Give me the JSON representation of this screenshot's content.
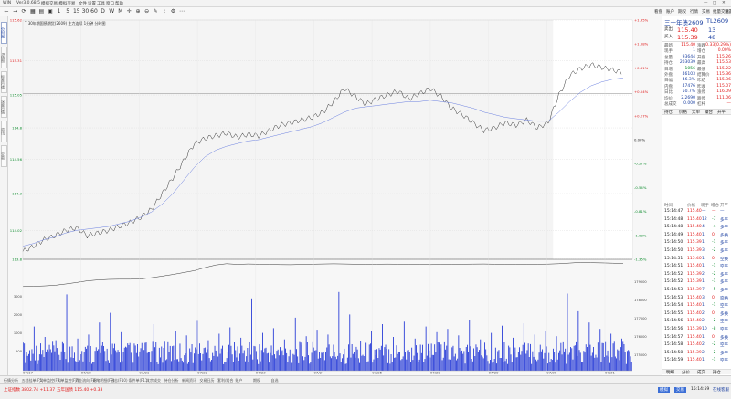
{
  "title_bar": {
    "app": "WIN",
    "version": "Ver3.0.68.5",
    "account": "模拟交易 模拟交易",
    "items": [
      "文件",
      "设置",
      "工具",
      "窗口",
      "帮助"
    ]
  },
  "window_controls": {
    "minimize": "—",
    "maximize": "□",
    "close": "✕"
  },
  "toolbar": {
    "icons": [
      "arrow-left-icon",
      "arrow-right-icon",
      "refresh-icon",
      "grid-icon",
      "doc-icon",
      "monitor-icon",
      "number-1-icon",
      "number-5-icon",
      "number-15-icon",
      "number-30-icon",
      "number-60-icon",
      "day-icon",
      "week-icon",
      "month-icon",
      "cross-icon",
      "zoom-in-icon",
      "zoom-out-icon",
      "draw-icon",
      "indicator-icon",
      "settings-icon",
      "more-icon"
    ],
    "glyphs": [
      "←",
      "→",
      "⟳",
      "▦",
      "▤",
      "▣",
      "1",
      "5",
      "15",
      "30",
      "60",
      "D",
      "W",
      "M",
      "✛",
      "⊕",
      "⊖",
      "✎",
      "⌇",
      "⚙",
      "⋯"
    ],
    "right_items": [
      "看盘",
      "账户",
      "期权",
      "行情",
      "交易",
      "批量交易",
      "设置"
    ]
  },
  "left_tabs": [
    "分时图",
    "K线图",
    "标准行情",
    "深度行情",
    "资讯",
    "交易"
  ],
  "chart_data": {
    "type": "line",
    "header": "T 30年期国债期货(2609) 主力连续 1分钟 分时图",
    "ylim": [
      113.8,
      115.62
    ],
    "y_ticks": [
      115.62,
      115.31,
      115.05,
      114.8,
      114.56,
      114.3,
      114.02,
      113.8
    ],
    "pct_ticks": [
      "+1.35%",
      "+1.08%",
      "+0.81%",
      "+0.54%",
      "+0.27%",
      "0.00%",
      "-0.27%",
      "-0.54%",
      "-0.81%",
      "-1.08%",
      "-1.35%"
    ],
    "pct_colors": {
      "up": "#e01818",
      "flat": "#222222",
      "down": "#0a8a2a"
    },
    "reference_price": 115.06,
    "x_labels": [
      "07/17",
      "07/18",
      "07/21",
      "07/22",
      "07/23",
      "07/24",
      "07/25",
      "07/28",
      "07/29",
      "07/30",
      "07/31"
    ],
    "price": [
      113.86,
      113.9,
      113.95,
      113.98,
      114.02,
      114.04,
      113.98,
      114.0,
      114.02,
      114.05,
      114.08,
      114.12,
      114.18,
      114.3,
      114.42,
      114.55,
      114.68,
      114.72,
      114.74,
      114.76,
      114.73,
      114.75,
      114.74,
      114.78,
      114.82,
      114.84,
      114.86,
      114.88,
      114.92,
      115.0,
      115.1,
      115.04,
      114.98,
      115.02,
      115.05,
      115.08,
      115.02,
      115.06,
      115.1,
      115.04,
      114.95,
      114.9,
      114.84,
      114.78,
      114.8,
      114.84,
      114.82,
      114.86,
      114.8,
      114.84,
      115.05,
      115.2,
      115.25,
      115.28,
      115.26,
      115.24,
      115.22
    ],
    "avg": [
      113.9,
      113.92,
      113.95,
      113.97,
      114.0,
      114.02,
      114.03,
      114.04,
      114.05,
      114.07,
      114.09,
      114.12,
      114.16,
      114.22,
      114.3,
      114.4,
      114.5,
      114.58,
      114.63,
      114.66,
      114.68,
      114.7,
      114.71,
      114.73,
      114.75,
      114.77,
      114.79,
      114.81,
      114.84,
      114.88,
      114.92,
      114.95,
      114.96,
      114.97,
      114.98,
      114.99,
      115.0,
      115.0,
      115.01,
      115.0,
      114.99,
      114.97,
      114.95,
      114.92,
      114.9,
      114.88,
      114.87,
      114.86,
      114.85,
      114.85,
      114.92,
      115.0,
      115.07,
      115.12,
      115.15,
      115.17,
      115.18
    ],
    "open_interest": [
      30,
      32,
      35,
      40,
      50,
      62,
      75,
      82,
      86,
      88,
      88,
      90,
      100,
      112,
      125,
      140,
      155,
      180,
      200,
      210,
      205,
      208,
      206,
      204,
      203,
      202,
      204,
      206,
      208,
      209,
      208,
      206,
      205,
      206,
      207,
      206,
      205,
      204,
      203,
      204,
      205,
      206,
      207,
      208,
      206,
      205,
      204,
      205,
      206,
      207,
      210,
      215,
      220,
      218,
      216,
      214,
      212
    ],
    "oi_labels": [
      "179000",
      "178000",
      "177000",
      "176000",
      "175000"
    ],
    "volume_labels": [
      "3000",
      "2000",
      "1000",
      "500"
    ],
    "volume_peaks": [
      0.35,
      0.55,
      0.42,
      0.38,
      0.95,
      0.4,
      0.45,
      0.6,
      0.72,
      0.48,
      0.52,
      0.4,
      0.58,
      0.36,
      0.5,
      0.44,
      0.62,
      0.38,
      0.46,
      0.54,
      0.41,
      0.9,
      0.47,
      0.53,
      0.39,
      0.66,
      0.43,
      0.51,
      0.45,
      0.98,
      0.7,
      0.37,
      0.49,
      0.58,
      0.42,
      0.61,
      0.4,
      0.55,
      0.48,
      0.52,
      0.44,
      0.63,
      0.39,
      0.47,
      0.56,
      0.41,
      0.59,
      0.45,
      0.5,
      0.43,
      0.96,
      0.74,
      0.6,
      0.52,
      0.46,
      0.4,
      0.36
    ]
  },
  "quote": {
    "name": "三十年债2609",
    "code": "TL2609",
    "sell_label": "卖出",
    "sell_price": "115.40",
    "sell_vol": "13",
    "buy_label": "买入",
    "buy_price": "115.39",
    "buy_vol": "48",
    "stats": [
      {
        "k": "最新",
        "v": "115.40",
        "k2": "涨跌",
        "v2": "0.33(0.29%)"
      },
      {
        "k": "现手",
        "v": "1",
        "k2": "增仓",
        "v2": "0.00%"
      },
      {
        "k": "总量",
        "v": "93644",
        "k2": "开盘",
        "v2": "115.26"
      },
      {
        "k": "持仓",
        "v": "203039",
        "k2": "最高",
        "v2": "115.53"
      },
      {
        "k": "日增",
        "v": "-1056",
        "k2": "最低",
        "v2": "115.22"
      },
      {
        "k": "外盘",
        "v": "46103",
        "k2": "结算价",
        "v2": "115.36"
      },
      {
        "k": "日幅",
        "v": "46.3%",
        "k2": "昨结",
        "v2": "115.36"
      },
      {
        "k": "内盘",
        "v": "47476",
        "k2": "昨收",
        "v2": "115.07"
      },
      {
        "k": "日比",
        "v": "50.7%",
        "k2": "涨停",
        "v2": "116.09"
      },
      {
        "k": "均价",
        "v": "2.2690",
        "k2": "跌停",
        "v2": "111.06"
      },
      {
        "k": "总成交",
        "v": "0.000",
        "k2": "杠杆",
        "v2": "—"
      }
    ],
    "mid_tabs": [
      "持仓",
      "价格",
      "大单",
      "撮合",
      "开平"
    ],
    "tick_header": [
      "时间",
      "价格",
      "现手",
      "增仓",
      "开平"
    ],
    "ticks": [
      [
        "15:14:47",
        "115.40",
        "—",
        "—",
        "—"
      ],
      [
        "15:14:48",
        "115.40",
        "12",
        "-7",
        "多平"
      ],
      [
        "15:14:48",
        "115.40",
        "4",
        "-4",
        "多平"
      ],
      [
        "15:14:49",
        "115.40",
        "1",
        "0",
        "多换"
      ],
      [
        "15:14:50",
        "115.39",
        "1",
        "-1",
        "多平"
      ],
      [
        "15:14:50",
        "115.39",
        "3",
        "-2",
        "多平"
      ],
      [
        "15:14:51",
        "115.40",
        "1",
        "0",
        "空换"
      ],
      [
        "15:14:51",
        "115.40",
        "1",
        "-1",
        "空平"
      ],
      [
        "15:14:52",
        "115.39",
        "2",
        "-2",
        "多平"
      ],
      [
        "15:14:52",
        "115.39",
        "1",
        "-1",
        "多平"
      ],
      [
        "15:14:53",
        "115.39",
        "7",
        "-5",
        "多平"
      ],
      [
        "15:14:53",
        "115.40",
        "3",
        "0",
        "空换"
      ],
      [
        "15:14:54",
        "115.40",
        "1",
        "-1",
        "空平"
      ],
      [
        "15:14:55",
        "115.40",
        "2",
        "0",
        "多换"
      ],
      [
        "15:14:56",
        "115.40",
        "2",
        "-2",
        "空平"
      ],
      [
        "15:14:56",
        "115.39",
        "10",
        "-8",
        "空平"
      ],
      [
        "15:14:57",
        "115.40",
        "1",
        "0",
        "多换"
      ],
      [
        "15:14:58",
        "115.40",
        "2",
        "-2",
        "空平"
      ],
      [
        "15:14:58",
        "115.39",
        "2",
        "-2",
        "多平"
      ],
      [
        "15:14:59",
        "115.40",
        "1",
        "-1",
        "空平"
      ]
    ],
    "bottom_tabs": [
      "明细",
      "分价",
      "成交",
      "持仓"
    ]
  },
  "bottom_tabs": [
    "行情分析",
    "五档挂单(F5)",
    "大单监控(F6)",
    "大单监控(F7)",
    "资金流向(F8)",
    "逐笔明细(F9)",
    "日志(F10)",
    "条件单(F11)",
    "大宗成交",
    "持仓分析",
    "新闻资讯",
    "交易日历",
    "套利/组合",
    "账户",
    "期权",
    "自选"
  ],
  "status": {
    "left": "上证指数 3802.74 +11.37",
    "mid": "五年国债 115.40 +0.33",
    "right_buttons": [
      "模拟",
      "交易"
    ],
    "clock": "15:14:59",
    "right_tag": "在线客服"
  }
}
